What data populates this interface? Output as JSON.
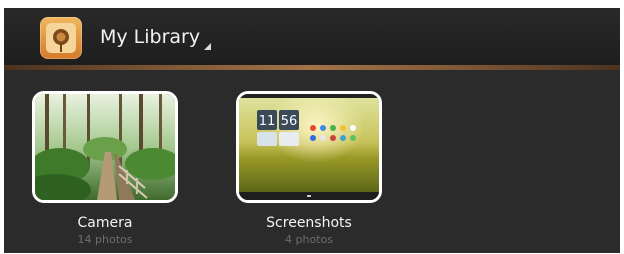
{
  "header": {
    "title": "My Library",
    "app_icon": "gallery-app-icon",
    "dropdown_icon": "dropdown-caret-icon"
  },
  "albums": [
    {
      "name": "Camera",
      "count": "14 photos",
      "thumbnail": "forest-boardwalk-photo"
    },
    {
      "name": "Screenshots",
      "count": "4 photos",
      "thumbnail": "tablet-homescreen-screenshot"
    }
  ],
  "colors": {
    "background": "#2b2b2b",
    "actionbar": "#1e1e1e",
    "divider": "#a37347",
    "text": "#f2f2f2",
    "subtext": "#6d6d6d"
  }
}
